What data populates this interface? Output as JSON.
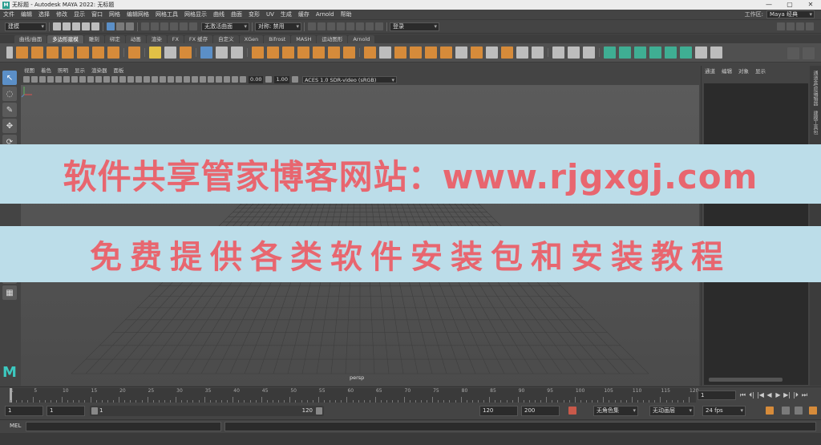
{
  "window": {
    "title": "无标题 - Autodesk MAYA 2022: 无标题",
    "controls": [
      "—",
      "▢",
      "✕"
    ]
  },
  "menubar": {
    "items": [
      "文件",
      "编辑",
      "选择",
      "修改",
      "显示",
      "窗口",
      "网格",
      "编辑网格",
      "网格工具",
      "网格显示",
      "曲线",
      "曲面",
      "变形",
      "UV",
      "生成",
      "缓存",
      "Arnold",
      "帮助"
    ],
    "workspace_label": "工作区:",
    "workspace_value": "Maya 经典"
  },
  "statusline": {
    "mode": "建模",
    "live_surface": "无激活曲面",
    "symmetry": "对称: 禁用",
    "login": "登录"
  },
  "shelf": {
    "tabs": [
      "曲线/曲面",
      "多边形建模",
      "雕刻",
      "绑定",
      "动画",
      "渲染",
      "FX",
      "FX 缓存",
      "自定义",
      "XGen",
      "Bifrost",
      "MASH",
      "运动图形",
      "Arnold"
    ],
    "active_tab": 1
  },
  "viewport": {
    "menu": [
      "视图",
      "着色",
      "照明",
      "显示",
      "渲染器",
      "面板"
    ],
    "exposure": "0.00",
    "gamma": "1.00",
    "colorspace": "ACES 1.0 SDR-video (sRGB)",
    "camera_label": "persp"
  },
  "channelbox": {
    "menu": [
      "通道",
      "编辑",
      "对象",
      "显示"
    ],
    "side_tabs": [
      "通道盒/层编辑器",
      "建模工具包"
    ]
  },
  "banners": {
    "line1": "软件共享管家博客网站：www.rjgxgj.com",
    "line2": "免费提供各类软件安装包和安装教程"
  },
  "timeslider": {
    "ticks": [
      "5",
      "10",
      "15",
      "20",
      "25",
      "30",
      "35",
      "40",
      "45",
      "50",
      "55",
      "60",
      "65",
      "70",
      "75",
      "80",
      "85",
      "90",
      "95",
      "100",
      "105",
      "110",
      "115",
      "120"
    ],
    "start_tick": "1",
    "current_frame": "1",
    "playback_icons": [
      "⏮",
      "⏴|",
      "|◀",
      "◀",
      "▶",
      "▶|",
      "|⏵",
      "⏭"
    ]
  },
  "range": {
    "start": "1",
    "playback_start": "1",
    "slider_start": "1",
    "slider_end": "120",
    "playback_end": "120",
    "end": "200",
    "character_set": "无角色集",
    "anim_layer": "无动画层",
    "fps": "24 fps"
  },
  "cmdline": {
    "label": "MEL"
  }
}
